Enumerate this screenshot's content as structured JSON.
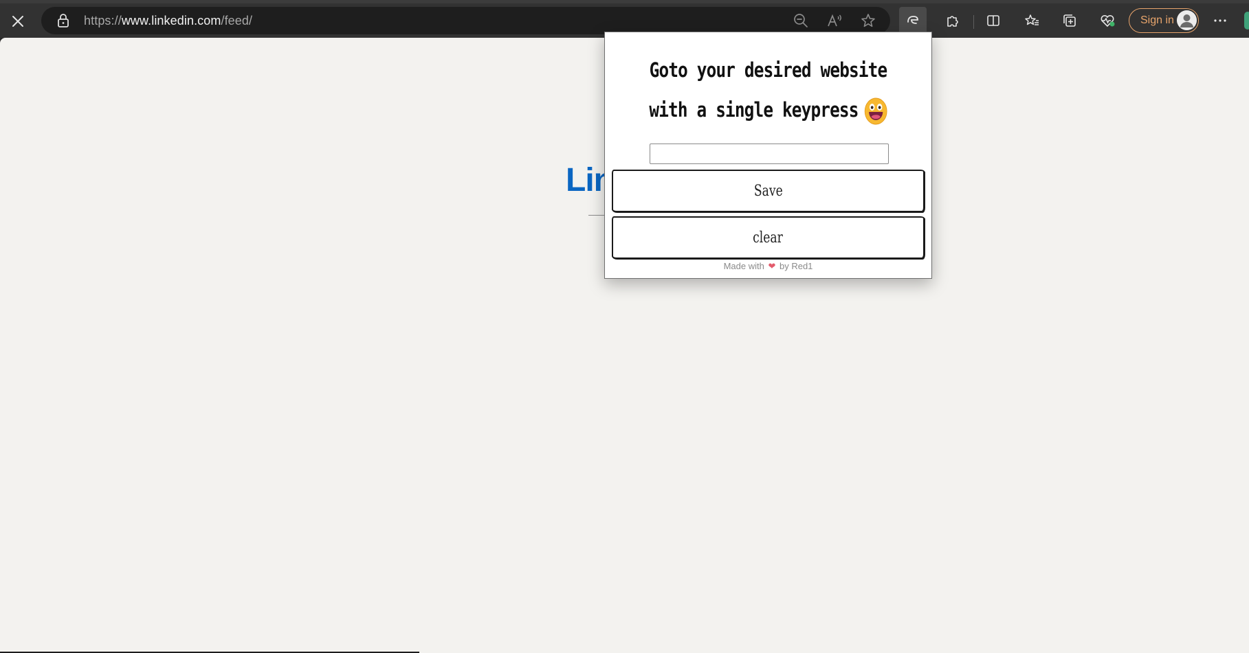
{
  "browser": {
    "url_prefix": "https://",
    "url_host": "www.linkedin.com",
    "url_path": "/feed/",
    "signin_label": "Sign in",
    "icons": [
      "close-icon",
      "lock-icon",
      "zoom-out-icon",
      "read-aloud-icon",
      "favorite-star-icon",
      "extension-active-icon",
      "extensions-puzzle-icon",
      "split-screen-icon",
      "favorites-icon",
      "collections-icon",
      "browser-essentials-icon",
      "avatar-icon",
      "more-menu-icon"
    ]
  },
  "page": {
    "logo_text": "Lin"
  },
  "popup": {
    "title": "Goto your desired website with a single keypress",
    "input_value": "",
    "input_placeholder": "",
    "save_label": "Save",
    "clear_label": "clear",
    "footer_made_with": "Made with",
    "footer_by": "by Red1",
    "heart_color": "#e35b6c"
  },
  "colors": {
    "toolbar": "#323232",
    "addressbar": "#1e1e1e",
    "signin_accent": "#e8a56c",
    "page_bg": "#f3f2ef",
    "linkedin_blue": "#0a66c2"
  }
}
